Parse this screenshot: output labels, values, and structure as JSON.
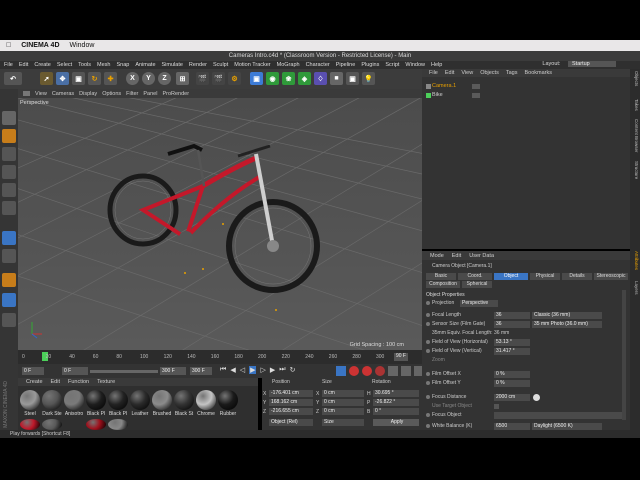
{
  "mac_menu": {
    "app": "CINEMA 4D",
    "items": [
      "Window"
    ]
  },
  "window_title": "Cameras Intro.c4d * (Classroom Version - Restricted License) - Main",
  "main_menu": [
    "File",
    "Edit",
    "Create",
    "Select",
    "Tools",
    "Mesh",
    "Snap",
    "Animate",
    "Simulate",
    "Render",
    "Sculpt",
    "Motion Tracker",
    "MoGraph",
    "Character",
    "Pipeline",
    "Plugins",
    "Script",
    "Window",
    "Help"
  ],
  "layout": {
    "label": "Layout:",
    "value": "Startup"
  },
  "toolbar_axes": [
    "X",
    "Y",
    "Z"
  ],
  "viewport": {
    "menu": [
      "View",
      "Cameras",
      "Display",
      "Options",
      "Filter",
      "Panel",
      "ProRender"
    ],
    "label": "Perspective",
    "grid_spacing": "Grid Spacing : 100 cm"
  },
  "timeline": {
    "ticks": [
      "0",
      "20",
      "40",
      "60",
      "80",
      "100",
      "120",
      "140",
      "160",
      "180",
      "200",
      "220",
      "240",
      "260",
      "280",
      "300"
    ],
    "current": "0 F",
    "end": "90 F"
  },
  "transport": {
    "start": "0 F",
    "start2": "0 F",
    "end": "300 F",
    "end2": "300 F"
  },
  "materials": {
    "menu": [
      "Create",
      "Edit",
      "Function",
      "Texture"
    ],
    "items": [
      {
        "label": "Steel",
        "color": "#9a9a9a"
      },
      {
        "label": "Dark Ste",
        "color": "#555555"
      },
      {
        "label": "Anisotro",
        "color": "#7a7a7a"
      },
      {
        "label": "Black Pl",
        "color": "#1e1e1e"
      },
      {
        "label": "Black Pl",
        "color": "#222222"
      },
      {
        "label": "Leather",
        "color": "#2a2a2a"
      },
      {
        "label": "Brushed",
        "color": "#8c8c8c"
      },
      {
        "label": "Black St",
        "color": "#333333"
      },
      {
        "label": "Chrome",
        "color": "#c4c4c4"
      },
      {
        "label": "Rubber",
        "color": "#1a1a1a"
      }
    ],
    "row2": [
      {
        "color": "#c0182a"
      },
      {
        "color": "#5a5a5a"
      },
      {
        "color": "#a0101c"
      },
      {
        "color": "#888888"
      }
    ]
  },
  "coordinates": {
    "headers": [
      "Position",
      "Size",
      "Rotation"
    ],
    "rows": [
      {
        "axis": "X",
        "pos": "-176.401 cm",
        "size": "0 cm",
        "rot_label": "H",
        "rot": "30.695 °"
      },
      {
        "axis": "Y",
        "pos": "168.162 cm",
        "size": "0 cm",
        "rot_label": "P",
        "rot": "-26.822 °"
      },
      {
        "axis": "Z",
        "pos": "-216.655 cm",
        "size": "0 cm",
        "rot_label": "B",
        "rot": "0 °"
      }
    ],
    "mode": "Object (Rel)",
    "size_mode": "Size",
    "apply": "Apply"
  },
  "object_manager": {
    "menu": [
      "File",
      "Edit",
      "View",
      "Objects",
      "Tags",
      "Bookmarks"
    ],
    "objects": [
      "Camera.1",
      "Bike"
    ]
  },
  "side_tabs": [
    "Objects",
    "Takes",
    "Content Browser",
    "Structure",
    "Attributes",
    "Layers"
  ],
  "attributes": {
    "menu": [
      "Mode",
      "Edit",
      "User Data"
    ],
    "header": "Camera Object [Camera.1]",
    "tabs": [
      "Basic",
      "Coord.",
      "Object",
      "Physical",
      "Details",
      "Stereoscopic",
      "Composition",
      "Spherical"
    ],
    "section": "Object Properties",
    "props": [
      {
        "label": "Projection",
        "value": "Perspective"
      },
      {
        "label": "Focal Length",
        "value": "36",
        "extra": "Classic (36 mm)"
      },
      {
        "label": "Sensor Size (Film Gate)",
        "value": "36",
        "extra": "35 mm Photo (36.0 mm)"
      },
      {
        "label": "35mm Equiv. Focal Length:",
        "value": "36 mm"
      },
      {
        "label": "Field of View (Horizontal)",
        "value": "53.13 °"
      },
      {
        "label": "Field of View (Vertical)",
        "value": "31.417 °"
      },
      {
        "label": "Zoom",
        "value": ""
      },
      {
        "label": "Film Offset X",
        "value": "0 %"
      },
      {
        "label": "Film Offset Y",
        "value": "0 %"
      },
      {
        "label": "Focus Distance",
        "value": "2000 cm"
      },
      {
        "label": "Use Target Object",
        "value": ""
      },
      {
        "label": "Focus Object",
        "value": ""
      },
      {
        "label": "White Balance (K)",
        "value": "6500",
        "extra": "Daylight (6500 K)"
      }
    ]
  },
  "status": "Play forwards [Shortcut F8]",
  "side_label": "MAXON CINEMA 4D"
}
